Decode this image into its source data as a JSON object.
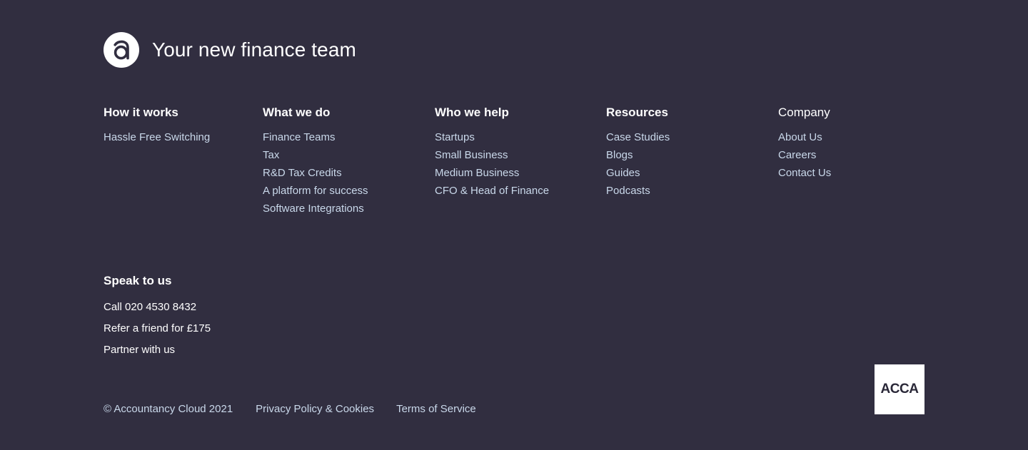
{
  "brand": {
    "logo_icon": "accountancy-cloud-a-logo",
    "tagline": "Your new finance team"
  },
  "columns": [
    {
      "heading": "How it works",
      "links": [
        "Hassle Free Switching"
      ]
    },
    {
      "heading": "What we do",
      "links": [
        "Finance Teams",
        "Tax",
        "R&D Tax Credits",
        "A platform for success",
        "Software Integrations"
      ]
    },
    {
      "heading": "Who we help",
      "links": [
        "Startups",
        "Small Business",
        "Medium Business",
        "CFO & Head of Finance"
      ]
    },
    {
      "heading": "Resources",
      "links": [
        "Case Studies",
        "Blogs",
        "Guides",
        "Podcasts"
      ]
    },
    {
      "heading": "Company",
      "links": [
        "About Us",
        "Careers",
        "Contact Us"
      ]
    }
  ],
  "speak": {
    "heading": "Speak to us",
    "links": [
      "Call 020 4530 8432",
      "Refer a friend for £175",
      "Partner with us"
    ]
  },
  "legal": {
    "copyright": "© Accountancy Cloud 2021",
    "privacy": "Privacy Policy & Cookies",
    "terms": "Terms of Service"
  },
  "badge": {
    "label": "ACCA"
  },
  "colors": {
    "background": "#312e40",
    "link": "#c9d8ea",
    "heading": "#ffffff"
  }
}
